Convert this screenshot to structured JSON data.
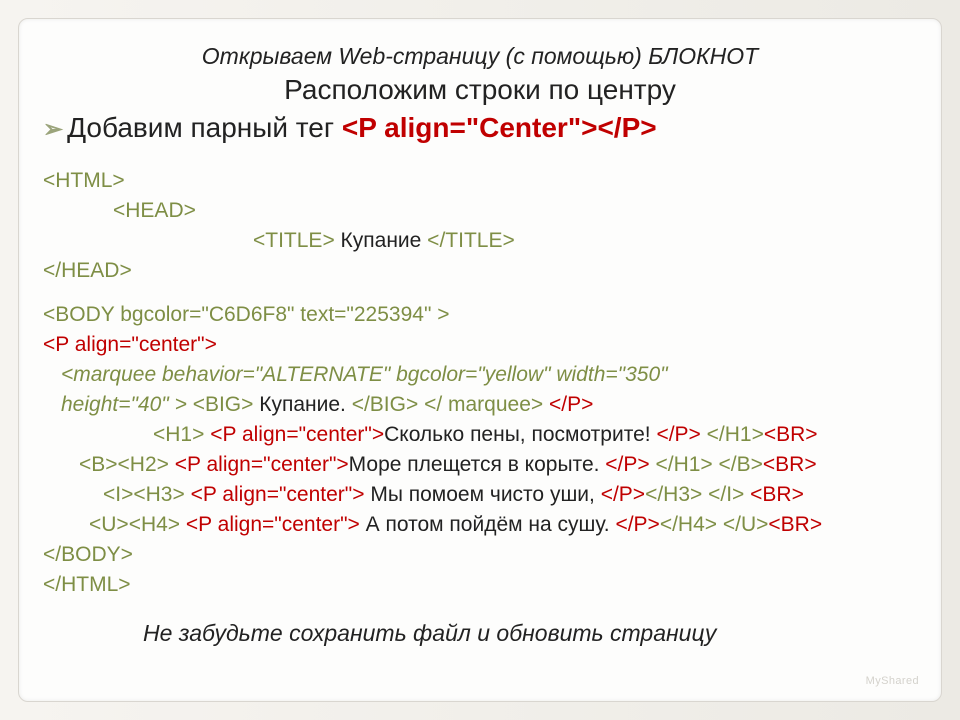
{
  "header": {
    "top_title": "Открываем Web-страницу (с помощью) БЛОКНОТ",
    "subtitle": "Расположим строки по центру",
    "bullet_prefix": "Добавим парный тег ",
    "bullet_tag": "<P align=\"Center\"></P>"
  },
  "code": {
    "l01": "<HTML>",
    "l02": "<HEAD>",
    "l03a": "<TITLE> ",
    "l03b": "Купание",
    "l03c": " </TITLE>",
    "l04": "</HEAD>",
    "l05": "<BODY bgcolor=\"C6D6F8\" text=\"225394\" >",
    "l06": "<P align=\"center\">",
    "l07": "<marquee  behavior=\"ALTERNATE\"   bgcolor=\"yellow\"  width=\"350\"",
    "l08a": "height=\"40\" > ",
    "l08b": "<BIG> ",
    "l08c": "Купание.",
    "l08d": " </BIG> </ marquee> ",
    "l08e": "</P>",
    "l09a": "<H1> ",
    "l09b": "<P align=\"center\">",
    "l09c": "Сколько пены, посмотрите!",
    "l09d": " </P>",
    "l09e": " </H1>",
    "l10a": "<B>",
    "l10b": "<H2> ",
    "l10c": "<P align=\"center\">",
    "l10d": "Море плещется в корыте.",
    "l10e": " </P>",
    "l10f": " </H1> </B>",
    "l11a": "<I>",
    "l11b": "<H3> ",
    "l11c": "<P align=\"center\">",
    "l11d": " Мы помоем чисто уши,",
    "l11e": " </P>",
    "l11f": "</H3> </I> ",
    "l12a": "<U>",
    "l12b": "<H4> ",
    "l12c": "<P align=\"center\">",
    "l12d": " А потом пойдём на сушу.",
    "l12e": " </P>",
    "l12f": "</H4> </U>",
    "l13": "</BODY>",
    "l14": "</HTML>",
    "br": "<BR>"
  },
  "footer": {
    "note": "Не забудьте сохранить файл и обновить страницу",
    "watermark": "MyShared"
  }
}
